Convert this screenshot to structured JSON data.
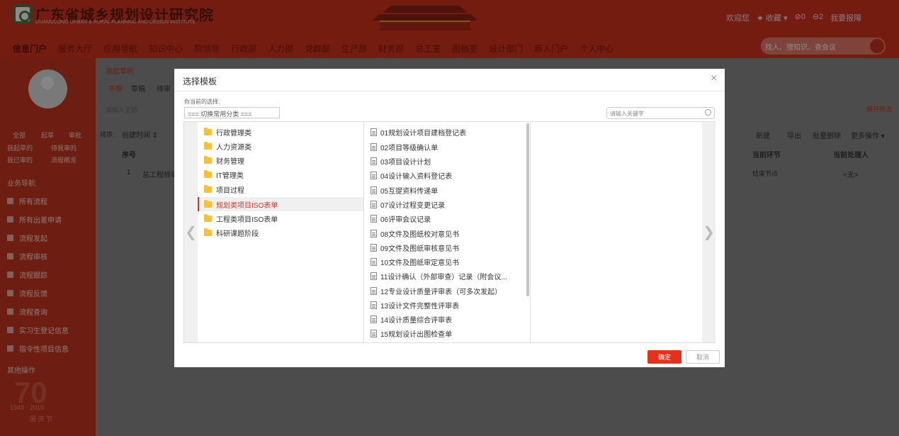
{
  "header": {
    "site_title": "广东省城乡规划设计研究院",
    "site_subtitle": "GUANGDONG URBAN & RURAL PLANNING AND DESIGN INSTITUTE",
    "welcome": "欢迎您",
    "favorites": "★ 收藏 ▾",
    "count_a": "⊘0",
    "count_b": "⊖2",
    "help": "我要报障",
    "search_placeholder": "找人、搜知识、查会议"
  },
  "nav": [
    "信息门户",
    "服务大厅",
    "应用导航",
    "知识中心",
    "院领导",
    "行政部",
    "人力部",
    "党群部",
    "生产部",
    "财务部",
    "总工室",
    "图档室",
    "设计部门",
    "新人门户",
    "个人中心"
  ],
  "sidebar": {
    "stats": [
      "全部",
      "起草",
      "审批"
    ],
    "links": [
      "我起草的",
      "待我审的",
      "我已审的",
      "流程概览"
    ],
    "section_business": "业务导航",
    "items": [
      "所有流程",
      "所有出差申请",
      "流程发起",
      "流程审核",
      "流程跟踪",
      "流程反馈",
      "流程查询",
      "实习生登记信息",
      "指令性项目信息"
    ],
    "section_other": "其他操作",
    "anniversary": "1949 · 2019",
    "national_day": "国 庆 节"
  },
  "main": {
    "tab_title": "我起草的",
    "filters": [
      "不限",
      "草稿",
      "待审"
    ],
    "subject_placeholder": "请输入主题",
    "expand_filter": "展开筛选",
    "sort_label": "排序:",
    "sort_field": "创建时间 ⇕",
    "actions": [
      "新建",
      "导出",
      "批量删除",
      "更多操作 ▾"
    ],
    "columns": [
      "序号",
      "当前环节",
      "当前处理人"
    ],
    "row": {
      "index": "1",
      "title": "总工程师审",
      "node": "结束节点",
      "handler": "<无>"
    }
  },
  "modal": {
    "title": "选择模板",
    "current_label": "你当前的选择:",
    "category_switch": "=== 切换常用分类 ===",
    "keyword_placeholder": "请输入关键字",
    "folders": [
      "行政管理类",
      "人力资源类",
      "财务管理",
      "IT管理类",
      "项目过程",
      "规划类项目ISO表单",
      "工程类项目ISO表单",
      "科研课题阶段"
    ],
    "selected_folder": 5,
    "files": [
      "01规划设计项目建档登记表",
      "02项目等级确认单",
      "03项目设计计划",
      "04设计输入资料登记表",
      "05互提资料传递单",
      "07设计过程变更记录",
      "06评审会议记录",
      "08文件及图纸校对意见书",
      "09文件及图纸审核意见书",
      "10文件及图纸审定意见书",
      "11设计确认（外部审查）记录（附会议...",
      "12专业设计质量评审表（可多次发起）",
      "13设计文件完整性评审表",
      "14设计质量综合评审表",
      "15规划设计出图检查单"
    ],
    "ok": "确定",
    "cancel": "取消"
  }
}
